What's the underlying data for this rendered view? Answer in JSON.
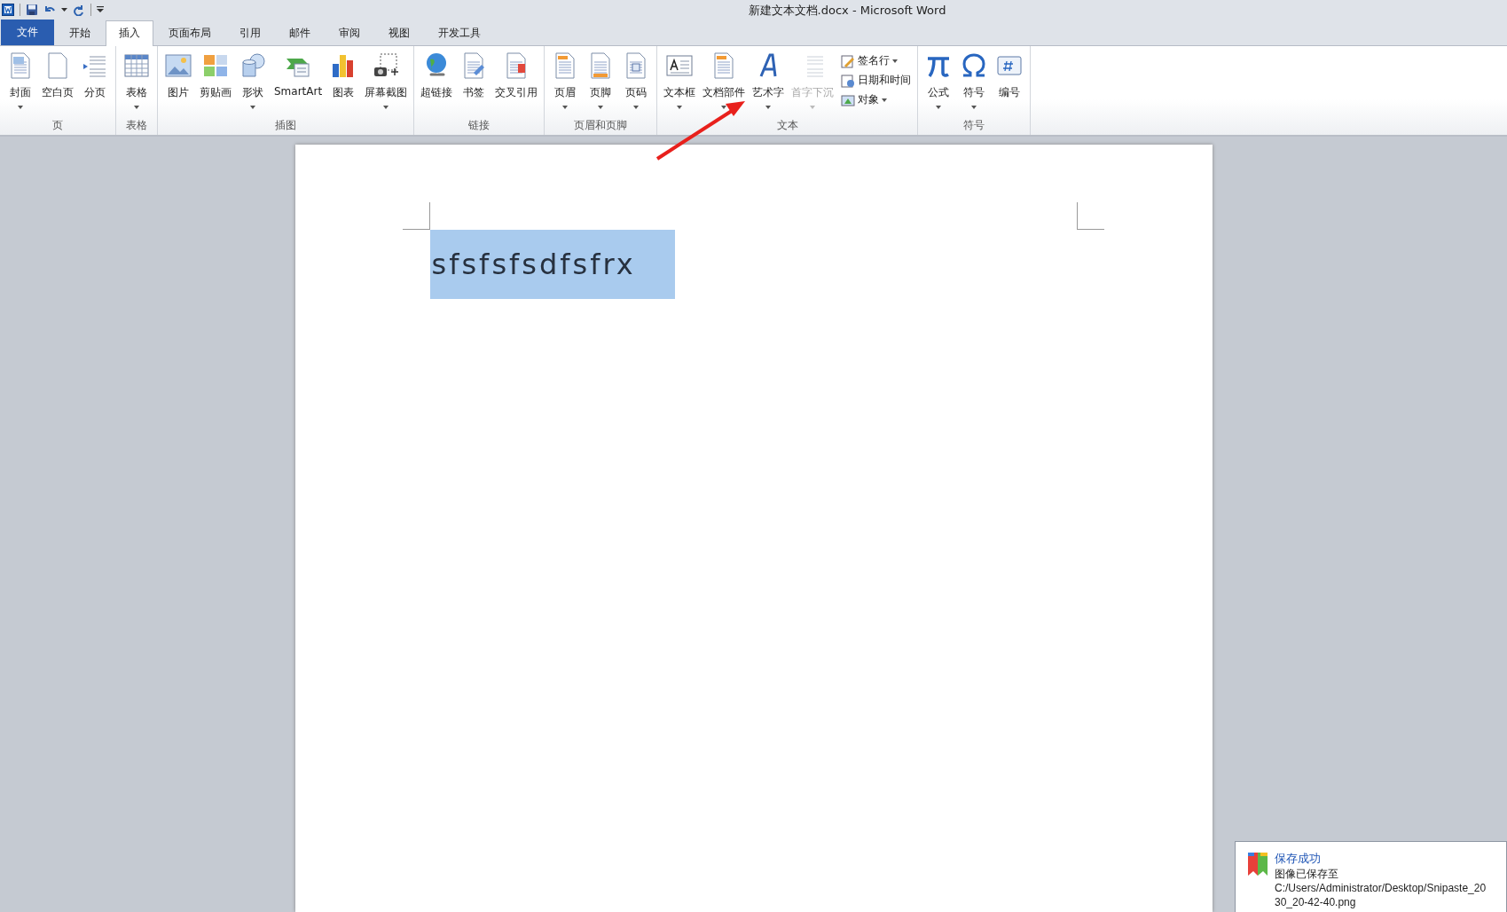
{
  "window": {
    "title": "新建文本文档.docx  -  Microsoft Word"
  },
  "tabs": [
    {
      "label": "文件",
      "kind": "file",
      "selected": false
    },
    {
      "label": "开始",
      "kind": "tab",
      "selected": false
    },
    {
      "label": "插入",
      "kind": "tab",
      "selected": true
    },
    {
      "label": "页面布局",
      "kind": "tab",
      "selected": false
    },
    {
      "label": "引用",
      "kind": "tab",
      "selected": false
    },
    {
      "label": "邮件",
      "kind": "tab",
      "selected": false
    },
    {
      "label": "审阅",
      "kind": "tab",
      "selected": false
    },
    {
      "label": "视图",
      "kind": "tab",
      "selected": false
    },
    {
      "label": "开发工具",
      "kind": "tab",
      "selected": false
    }
  ],
  "ribbon_groups": [
    {
      "label": "页",
      "buttons": [
        {
          "label": "封面",
          "kind": "large",
          "dropdown": true,
          "disabled": false
        },
        {
          "label": "空白页",
          "kind": "large",
          "dropdown": false,
          "disabled": false
        },
        {
          "label": "分页",
          "kind": "large",
          "dropdown": false,
          "disabled": false
        }
      ]
    },
    {
      "label": "表格",
      "buttons": [
        {
          "label": "表格",
          "kind": "large",
          "dropdown": true,
          "disabled": false
        }
      ]
    },
    {
      "label": "插图",
      "buttons": [
        {
          "label": "图片",
          "kind": "large",
          "dropdown": false,
          "disabled": false
        },
        {
          "label": "剪贴画",
          "kind": "large",
          "dropdown": false,
          "disabled": false
        },
        {
          "label": "形状",
          "kind": "large",
          "dropdown": true,
          "disabled": false
        },
        {
          "label": "SmartArt",
          "kind": "large",
          "dropdown": false,
          "disabled": false
        },
        {
          "label": "图表",
          "kind": "large",
          "dropdown": false,
          "disabled": false
        },
        {
          "label": "屏幕截图",
          "kind": "large",
          "dropdown": true,
          "disabled": false
        }
      ]
    },
    {
      "label": "链接",
      "buttons": [
        {
          "label": "超链接",
          "kind": "large",
          "dropdown": false,
          "disabled": false
        },
        {
          "label": "书签",
          "kind": "large",
          "dropdown": false,
          "disabled": false
        },
        {
          "label": "交叉引用",
          "kind": "large",
          "dropdown": false,
          "disabled": false
        }
      ]
    },
    {
      "label": "页眉和页脚",
      "buttons": [
        {
          "label": "页眉",
          "kind": "large",
          "dropdown": true,
          "disabled": false
        },
        {
          "label": "页脚",
          "kind": "large",
          "dropdown": true,
          "disabled": false
        },
        {
          "label": "页码",
          "kind": "large",
          "dropdown": true,
          "disabled": false
        }
      ]
    },
    {
      "label": "文本",
      "buttons": [
        {
          "label": "文本框",
          "kind": "large",
          "dropdown": true,
          "disabled": false
        },
        {
          "label": "文档部件",
          "kind": "large",
          "dropdown": true,
          "disabled": false
        },
        {
          "label": "艺术字",
          "kind": "large",
          "dropdown": true,
          "disabled": false
        },
        {
          "label": "首字下沉",
          "kind": "large",
          "dropdown": true,
          "disabled": true
        },
        {
          "label": "签名行",
          "kind": "small",
          "dropdown": true,
          "disabled": false
        },
        {
          "label": "日期和时间",
          "kind": "small",
          "dropdown": false,
          "disabled": false
        },
        {
          "label": "对象",
          "kind": "small",
          "dropdown": true,
          "disabled": false
        }
      ]
    },
    {
      "label": "符号",
      "buttons": [
        {
          "label": "公式",
          "kind": "large",
          "dropdown": true,
          "disabled": false
        },
        {
          "label": "符号",
          "kind": "large",
          "dropdown": true,
          "disabled": false
        },
        {
          "label": "编号",
          "kind": "large",
          "dropdown": false,
          "disabled": false
        }
      ]
    }
  ],
  "document": {
    "text": "sfsfsfsdfsfrx",
    "selected": true
  },
  "notification": {
    "title": "保存成功",
    "lines": [
      "图像已保存至",
      "C:/Users/Administrator/Desktop/Snipaste_20",
      "30_20-42-40.png"
    ]
  }
}
